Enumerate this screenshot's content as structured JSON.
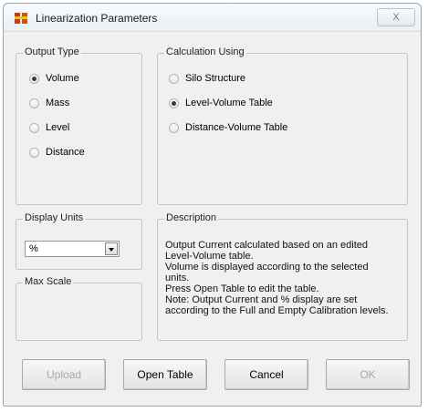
{
  "window": {
    "title": "Linearization Parameters",
    "close_label": "X"
  },
  "output_type": {
    "legend": "Output Type",
    "options": [
      {
        "label": "Volume",
        "checked": true
      },
      {
        "label": "Mass",
        "checked": false
      },
      {
        "label": "Level",
        "checked": false
      },
      {
        "label": "Distance",
        "checked": false
      }
    ]
  },
  "calculation": {
    "legend": "Calculation Using",
    "options": [
      {
        "label": "Silo Structure",
        "checked": false
      },
      {
        "label": "Level-Volume Table",
        "checked": true
      },
      {
        "label": "Distance-Volume Table",
        "checked": false
      }
    ]
  },
  "display_units": {
    "legend": "Display Units",
    "value": "%"
  },
  "max_scale": {
    "legend": "Max Scale"
  },
  "description": {
    "legend": "Description",
    "text": "Output Current calculated based on an edited\nLevel-Volume table.\nVolume is displayed according to the selected\nunits.\nPress Open Table to edit the table.\nNote: Output Current and % display are set\naccording to the Full and Empty Calibration levels."
  },
  "buttons": {
    "upload": "Upload",
    "open_table": "Open Table",
    "cancel": "Cancel",
    "ok": "OK"
  }
}
